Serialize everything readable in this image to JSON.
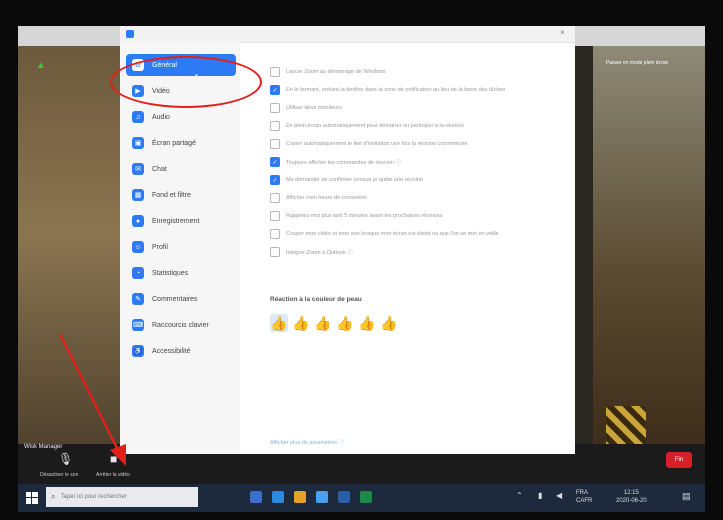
{
  "settings": {
    "sidebar": [
      {
        "label": "Général",
        "icon": "gear-icon",
        "glyph": "⚙"
      },
      {
        "label": "Vidéo",
        "icon": "video-icon",
        "glyph": "▶"
      },
      {
        "label": "Audio",
        "icon": "headphones-icon",
        "glyph": "♫"
      },
      {
        "label": "Écran partagé",
        "icon": "share-screen-icon",
        "glyph": "▣"
      },
      {
        "label": "Chat",
        "icon": "chat-icon",
        "glyph": "✉"
      },
      {
        "label": "Fond et filtre",
        "icon": "background-filter-icon",
        "glyph": "▦"
      },
      {
        "label": "Enregistrement",
        "icon": "record-icon",
        "glyph": "●"
      },
      {
        "label": "Profil",
        "icon": "profile-icon",
        "glyph": "☺"
      },
      {
        "label": "Statistiques",
        "icon": "statistics-icon",
        "glyph": "◔"
      },
      {
        "label": "Commentaires",
        "icon": "feedback-icon",
        "glyph": "✎"
      },
      {
        "label": "Raccourcis clavier",
        "icon": "keyboard-icon",
        "glyph": "⌨"
      },
      {
        "label": "Accessibilité",
        "icon": "accessibility-icon",
        "glyph": "♿"
      }
    ],
    "options": [
      {
        "label": "Lancer Zoom au démarrage de Windows",
        "checked": false
      },
      {
        "label": "En le fermant, réduire la fenêtre dans la zone de notification au lieu de la barre des tâches",
        "checked": true
      },
      {
        "label": "Utiliser deux moniteurs",
        "checked": false
      },
      {
        "label": "En plein écran automatiquement pour démarrer ou participer à la réunion",
        "checked": false
      },
      {
        "label": "Copier automatiquement le lien d'invitation une fois la réunion commencée",
        "checked": false
      },
      {
        "label": "Toujours afficher les commandes de réunion ⓘ",
        "checked": true
      },
      {
        "label": "Me demander de confirmer lorsque je quitte une réunion",
        "checked": true
      },
      {
        "label": "Afficher mon heure de connexion",
        "checked": false
      },
      {
        "label": "Rappelez-moi plus tard   5   minutes avant les prochaines réunions",
        "checked": false
      },
      {
        "label": "Couper mon vidéo et mon son lorsque mon écran est éteint ou que l'on se met en veille",
        "checked": false
      },
      {
        "label": "Intégrer Zoom à Outlook ⓘ",
        "checked": false
      }
    ],
    "skin_tone_title": "Réaction à la couleur de peau",
    "skin_tones": [
      "#f2c01b",
      "#f1d3b3",
      "#e0b58c",
      "#c28e64",
      "#8d5d3c",
      "#5c3e2b"
    ],
    "advanced_link": "Afficher plus de paramètres ⓘ"
  },
  "meeting": {
    "speaker_name": "Wisk Manager",
    "mute_label": "Désactiver le son",
    "video_label": "Arrêter la vidéo",
    "end_label": "Fin",
    "top_right_label": "Passer en mode plein écran"
  },
  "taskbar": {
    "search_placeholder": "Taper ici pour rechercher",
    "time": "12:15",
    "date": "2020-06-20",
    "lang_line1": "FRA",
    "lang_line2": "CAFR"
  },
  "colors": {
    "accent": "#2d7bf4",
    "annotation": "#e0201a"
  }
}
